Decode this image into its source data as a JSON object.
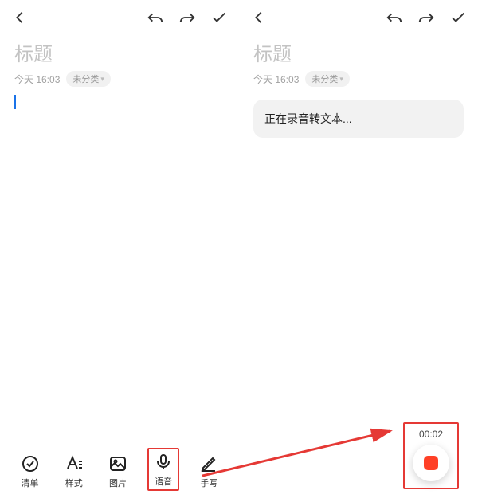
{
  "colors": {
    "highlight": "#e53935",
    "record": "#ff4026",
    "cursor": "#1a73e8"
  },
  "left": {
    "title_placeholder": "标题",
    "timestamp": "今天 16:03",
    "category": "未分类",
    "toolbar": [
      {
        "id": "checklist",
        "label": "清单",
        "icon": "checklist-icon"
      },
      {
        "id": "style",
        "label": "样式",
        "icon": "text-style-icon"
      },
      {
        "id": "image",
        "label": "图片",
        "icon": "image-icon"
      },
      {
        "id": "voice",
        "label": "语音",
        "icon": "microphone-icon",
        "highlighted": true
      },
      {
        "id": "handwrite",
        "label": "手写",
        "icon": "pen-icon"
      }
    ]
  },
  "right": {
    "title_placeholder": "标题",
    "timestamp": "今天 16:03",
    "category": "未分类",
    "status_text": "正在录音转文本...",
    "record_time": "00:02"
  },
  "topbar_icons": [
    "back",
    "undo",
    "redo",
    "confirm"
  ]
}
